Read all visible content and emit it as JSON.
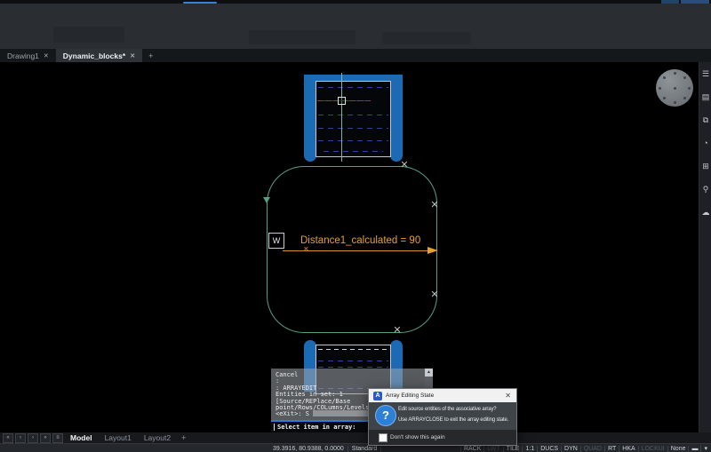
{
  "tabs": {
    "items": [
      {
        "label": "Drawing1"
      },
      {
        "label": "Dynamic_blocks*"
      }
    ],
    "close_glyph": "✕",
    "add_glyph": "+"
  },
  "canvas": {
    "dimension": {
      "label": "Distance1_calculated = 90",
      "w_marker": "W",
      "x_marker": "✕"
    },
    "case_markers": {
      "glyph": "✕"
    },
    "colors": {
      "strap_blue": "#1c6ab3",
      "outline_teal": "#57a182",
      "dimension_orange": "#e8a030",
      "crosshair_red": "#a7323e",
      "crosshair_green": "#8fae9e",
      "dash_navy": "#2a4694",
      "top_accent_blue": "#3f7fd0"
    }
  },
  "right_panel": {
    "icons": [
      {
        "name": "filter-icon",
        "glyph": "☰"
      },
      {
        "name": "layers-icon",
        "glyph": "▤"
      },
      {
        "name": "clipboard-icon",
        "glyph": "⧉"
      },
      {
        "name": "hatch-icon",
        "glyph": "◔"
      },
      {
        "name": "blocks-icon",
        "glyph": "⊞"
      },
      {
        "name": "light-icon",
        "glyph": "⚲"
      },
      {
        "name": "cloud-icon",
        "glyph": "☁"
      }
    ]
  },
  "command_panel": {
    "lines": [
      "Cancel",
      ":",
      ": ARRAYEDIT",
      "Entities in set: 1",
      "[Source/REPlace/Base",
      "point/Rows/COLumns/Levels/RES",
      "<eXit>: S"
    ],
    "prompt": "Select item in array:",
    "scroll_up_glyph": "▲"
  },
  "dialog": {
    "title": "Array Editing State",
    "app_icon_letter": "A",
    "close_glyph": "✕",
    "question_mark": "?",
    "message_line1": "Edit source entities of the associative array?",
    "message_line2": "Use ARRAYCLOSE to exit the array editing state.",
    "checkbox_label": "Don't show this again"
  },
  "layout_bar": {
    "nav": [
      {
        "name": "first-tab-button",
        "glyph": "«"
      },
      {
        "name": "prev-tab-button",
        "glyph": "‹"
      },
      {
        "name": "next-tab-button",
        "glyph": "›"
      },
      {
        "name": "last-tab-button",
        "glyph": "»"
      },
      {
        "name": "tab-list-button",
        "glyph": "≡"
      }
    ],
    "tabs": [
      {
        "label": "Model",
        "active": true
      },
      {
        "label": "Layout1",
        "active": false
      },
      {
        "label": "Layout2",
        "active": false
      }
    ],
    "add_glyph": "+"
  },
  "status_bar": {
    "coordinates": "39.3916, 80.9388, 0.0000",
    "style": "Standard",
    "toggles": [
      {
        "label": "RACK",
        "on": true
      },
      {
        "label": "LWT",
        "on": false
      },
      {
        "label": "TILE",
        "on": true
      },
      {
        "label": "1:1",
        "on": true
      },
      {
        "label": "DUCS",
        "on": true
      },
      {
        "label": "DYN",
        "on": true
      },
      {
        "label": "QUAD",
        "on": false
      },
      {
        "label": "RT",
        "on": true
      },
      {
        "label": "HKA",
        "on": true
      },
      {
        "label": "LOCKUI",
        "on": false
      },
      {
        "label": "None",
        "on": true
      }
    ],
    "lineweight_glyph": "▬",
    "caret_glyph": "▾"
  }
}
